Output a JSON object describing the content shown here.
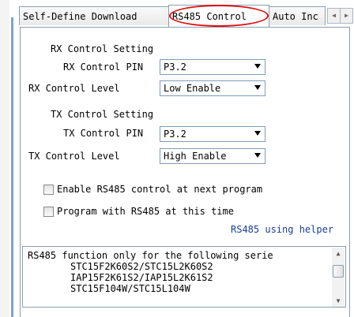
{
  "tabs": [
    {
      "label": "Self-Define Download"
    },
    {
      "label": "RS485 Control"
    },
    {
      "label": "Auto Inc"
    }
  ],
  "tab_scroll": {
    "left_icon": "chevron-left-icon",
    "right_icon": "chevron-right-icon"
  },
  "rx": {
    "group_title": "RX Control Setting",
    "pin_label": "RX Control PIN",
    "pin_value": "P3.2",
    "level_label": "RX Control Level",
    "level_value": "Low Enable"
  },
  "tx": {
    "group_title": "TX Control Setting",
    "pin_label": "TX Control PIN",
    "pin_value": "P3.2",
    "level_label": "TX Control Level",
    "level_value": "High Enable"
  },
  "options": {
    "enable_next": {
      "label": "Enable RS485 control at next program",
      "checked": false
    },
    "program_with": {
      "label": "Program with RS485 at this time",
      "checked": false
    }
  },
  "helper_link": "RS485 using helper",
  "info": {
    "lines": [
      "RS485 function only for the following serie",
      "STC15F2K60S2/STC15L2K60S2",
      "IAP15F2K61S2/IAP15L2K61S2",
      "STC15F104W/STC15L104W"
    ]
  },
  "colors": {
    "highlight": "#dd1111",
    "link": "#1a3d9a"
  }
}
